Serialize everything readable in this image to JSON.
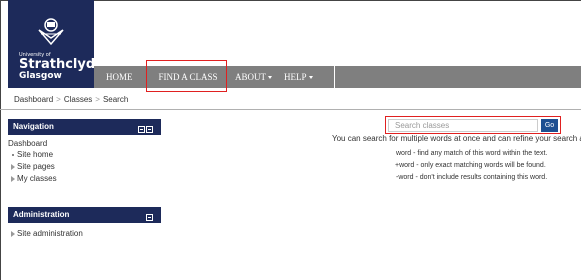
{
  "brand": {
    "university_of": "University of",
    "name": "Strathclyde",
    "city": "Glasgow",
    "colors": {
      "primary": "#1d2a5a",
      "navbar": "#7f7f7f",
      "highlight": "#e02020",
      "button": "#1d4f91"
    }
  },
  "navbar": {
    "items": [
      {
        "label": "HOME"
      },
      {
        "label": "FIND A CLASS"
      },
      {
        "label": "ABOUT"
      },
      {
        "label": "HELP"
      }
    ]
  },
  "breadcrumb": {
    "items": [
      "Dashboard",
      "Classes",
      "Search"
    ],
    "separator": ">"
  },
  "navigation_block": {
    "title": "Navigation",
    "root": "Dashboard",
    "items": [
      {
        "label": "Site home",
        "icon": "bullet-icon"
      },
      {
        "label": "Site pages",
        "icon": "expand-icon"
      },
      {
        "label": "My classes",
        "icon": "expand-icon"
      }
    ]
  },
  "admin_block": {
    "title": "Administration",
    "items": [
      {
        "label": "Site administration",
        "icon": "expand-icon"
      }
    ]
  },
  "search": {
    "placeholder": "Search classes",
    "button_label": "Go",
    "help_line": "You can search for multiple words at once and can refine your search a",
    "tips": [
      "word - find any match of this word within the text.",
      "+word - only exact matching words will be found.",
      "-word - don't include results containing this word."
    ]
  }
}
